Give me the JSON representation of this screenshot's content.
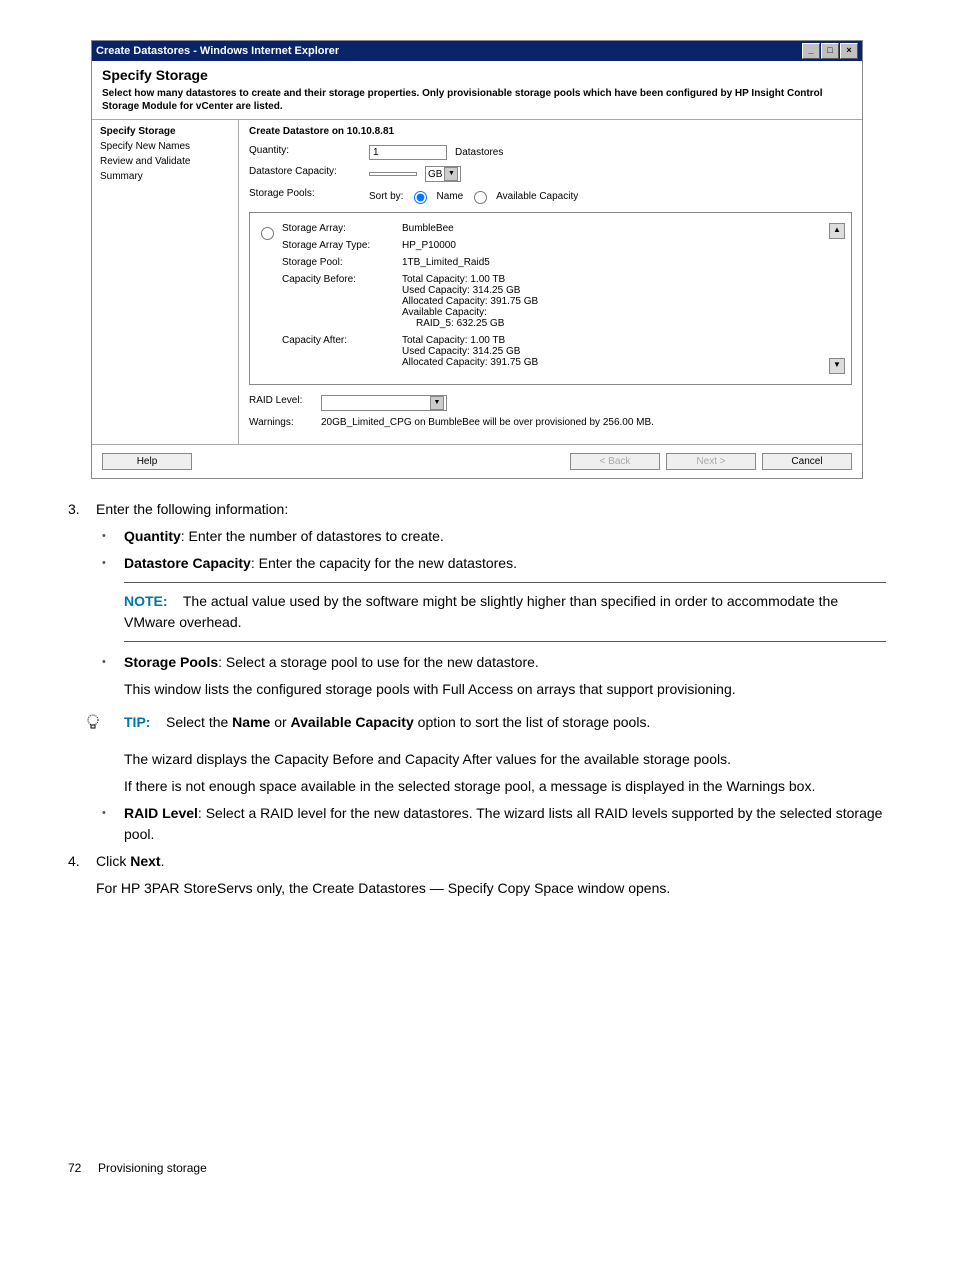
{
  "window": {
    "title": "Create Datastores - Windows Internet Explorer"
  },
  "dialog": {
    "title": "Specify Storage",
    "desc": "Select how many datastores to create and their storage properties. Only provisionable storage pools which have been configured by HP Insight Control Storage Module for vCenter are listed."
  },
  "nav": {
    "step1": "Specify Storage",
    "step2": "Specify New Names",
    "step3": "Review and Validate",
    "step4": "Summary"
  },
  "form": {
    "section_title": "Create Datastore on 10.10.8.81",
    "quantity_label": "Quantity:",
    "quantity_value": "1",
    "quantity_suffix": "Datastores",
    "capacity_label": "Datastore Capacity:",
    "capacity_value": "",
    "capacity_unit": "GB",
    "pools_label": "Storage Pools:",
    "sortby_label": "Sort by:",
    "sortby_name": "Name",
    "sortby_avail": "Available Capacity"
  },
  "pool": {
    "array_label": "Storage Array:",
    "array_value": "BumbleBee",
    "type_label": "Storage Array Type:",
    "type_value": "HP_P10000",
    "pool_label": "Storage Pool:",
    "pool_value": "1TB_Limited_Raid5",
    "before_label": "Capacity Before:",
    "before_l1": "Total Capacity: 1.00 TB",
    "before_l2": "Used Capacity: 314.25 GB",
    "before_l3": "Allocated Capacity: 391.75 GB",
    "before_l4": "Available Capacity:",
    "before_l5": "RAID_5: 632.25 GB",
    "after_label": "Capacity After:",
    "after_l1": "Total Capacity: 1.00 TB",
    "after_l2": "Used Capacity: 314.25 GB",
    "after_l3": "Allocated Capacity: 391.75 GB"
  },
  "bottom": {
    "raid_label": "RAID Level:",
    "raid_value": "",
    "warn_label": "Warnings:",
    "warn_value": "20GB_Limited_CPG on BumbleBee will be over provisioned by 256.00 MB."
  },
  "buttons": {
    "help": "Help",
    "back": "< Back",
    "next": "Next >",
    "cancel": "Cancel"
  },
  "doc": {
    "step3_num": "3.",
    "step3_text": "Enter the following information:",
    "b1_strong": "Quantity",
    "b1_rest": ": Enter the number of datastores to create.",
    "b2_strong": "Datastore Capacity",
    "b2_rest": ": Enter the capacity for the new datastores.",
    "note_label": "NOTE:",
    "note_text": "The actual value used by the software might be slightly higher than specified in order to accommodate the VMware overhead.",
    "b3_strong": "Storage Pools",
    "b3_rest": ": Select a storage pool to use for the new datastore.",
    "b3_p2": "This window lists the configured storage pools with Full Access on arrays that support provisioning.",
    "tip_label": "TIP:",
    "tip_t1": "Select the ",
    "tip_name": "Name",
    "tip_or": " or ",
    "tip_avail": "Available Capacity",
    "tip_t2": " option to sort the list of storage pools.",
    "p_after_tip1": "The wizard displays the Capacity Before and Capacity After values for the available storage pools.",
    "p_after_tip2": "If there is not enough space available in the selected storage pool, a message is displayed in the Warnings box.",
    "b4_strong": "RAID Level",
    "b4_rest": ": Select a RAID level for the new datastores. The wizard lists all RAID levels supported by the selected storage pool.",
    "step4_num": "4.",
    "step4_t1": "Click ",
    "step4_next": "Next",
    "step4_t2": ".",
    "step4_p": "For HP 3PAR StoreServs only, the Create Datastores — Specify Copy Space window opens.",
    "page_num": "72",
    "page_section": "Provisioning storage"
  }
}
